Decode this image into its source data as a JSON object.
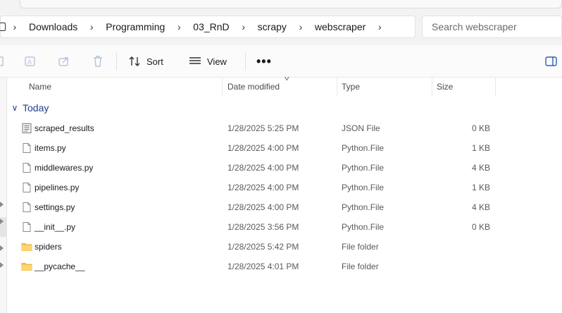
{
  "breadcrumb": [
    "Downloads",
    "Programming",
    "03_RnD",
    "scrapy",
    "webscraper"
  ],
  "search": {
    "placeholder": "Search webscraper"
  },
  "toolbar": {
    "sort_label": "Sort",
    "view_label": "View",
    "more_label": "•••"
  },
  "columns": {
    "name": "Name",
    "date": "Date modified",
    "type": "Type",
    "size": "Size"
  },
  "group": {
    "label": "Today"
  },
  "files": [
    {
      "name": "scraped_results",
      "date": "1/28/2025 5:25 PM",
      "type": "JSON File",
      "size": "0 KB",
      "icon": "json-file-icon"
    },
    {
      "name": "items.py",
      "date": "1/28/2025 4:00 PM",
      "type": "Python.File",
      "size": "1 KB",
      "icon": "python-file-icon"
    },
    {
      "name": "middlewares.py",
      "date": "1/28/2025 4:00 PM",
      "type": "Python.File",
      "size": "4 KB",
      "icon": "python-file-icon"
    },
    {
      "name": "pipelines.py",
      "date": "1/28/2025 4:00 PM",
      "type": "Python.File",
      "size": "1 KB",
      "icon": "python-file-icon"
    },
    {
      "name": "settings.py",
      "date": "1/28/2025 4:00 PM",
      "type": "Python.File",
      "size": "4 KB",
      "icon": "python-file-icon"
    },
    {
      "name": "__init__.py",
      "date": "1/28/2025 3:56 PM",
      "type": "Python.File",
      "size": "0 KB",
      "icon": "python-file-icon"
    },
    {
      "name": "spiders",
      "date": "1/28/2025 5:42 PM",
      "type": "File folder",
      "size": "",
      "icon": "folder-icon"
    },
    {
      "name": "__pycache__",
      "date": "1/28/2025 4:01 PM",
      "type": "File folder",
      "size": "",
      "icon": "folder-icon"
    }
  ],
  "colors": {
    "accent": "#1f3f8f",
    "folder": "#f4c44d",
    "chrome": "#f3f3f3"
  }
}
